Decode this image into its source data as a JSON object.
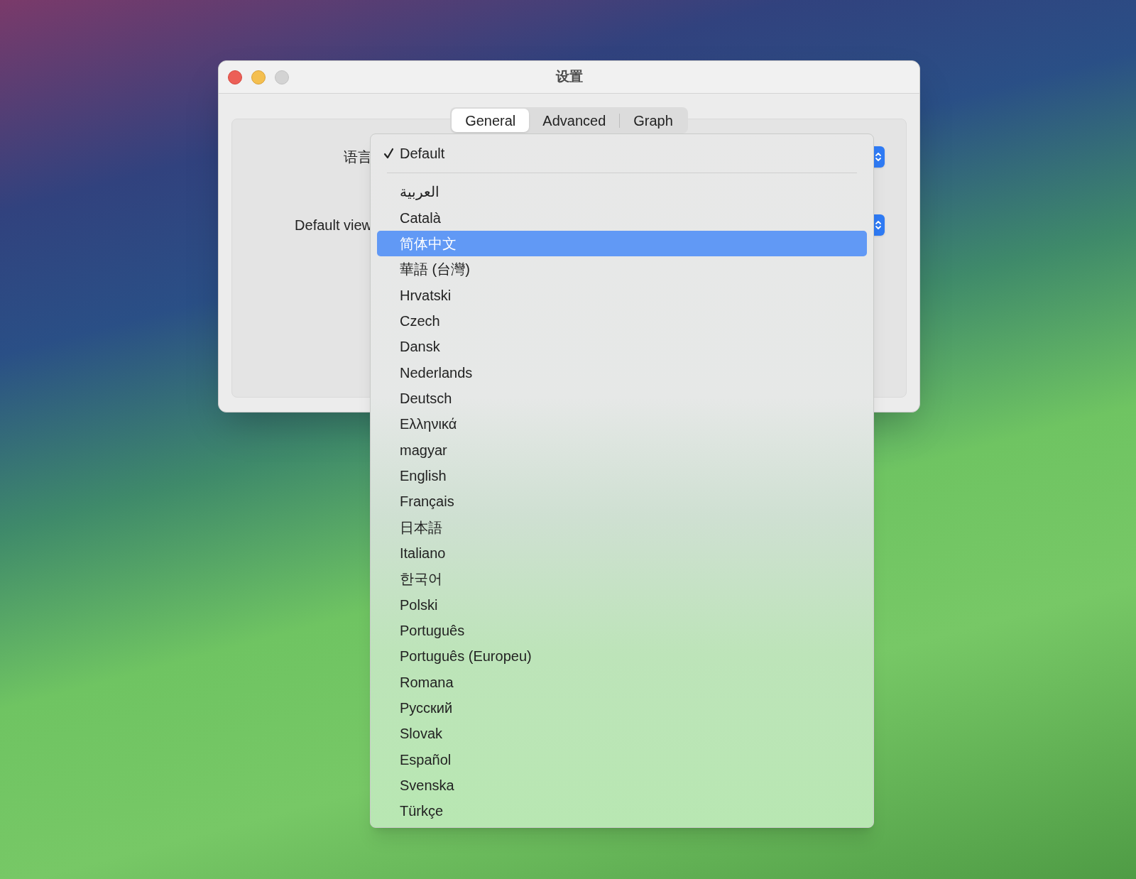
{
  "window": {
    "title": "设置"
  },
  "tabs": [
    {
      "label": "General",
      "selected": true
    },
    {
      "label": "Advanced",
      "selected": false
    },
    {
      "label": "Graph",
      "selected": false
    }
  ],
  "fields": [
    {
      "label": "语言"
    },
    {
      "label": "Default view"
    }
  ],
  "menu": {
    "items": [
      {
        "kind": "option",
        "label": "Default",
        "checked": true,
        "selected": false
      },
      {
        "kind": "separator"
      },
      {
        "kind": "option",
        "label": "العربية",
        "checked": false,
        "selected": false
      },
      {
        "kind": "option",
        "label": "Català",
        "checked": false,
        "selected": false
      },
      {
        "kind": "option",
        "label": "简体中文",
        "checked": false,
        "selected": true
      },
      {
        "kind": "option",
        "label": "華語 (台灣)",
        "checked": false,
        "selected": false
      },
      {
        "kind": "option",
        "label": "Hrvatski",
        "checked": false,
        "selected": false
      },
      {
        "kind": "option",
        "label": "Czech",
        "checked": false,
        "selected": false
      },
      {
        "kind": "option",
        "label": "Dansk",
        "checked": false,
        "selected": false
      },
      {
        "kind": "option",
        "label": "Nederlands",
        "checked": false,
        "selected": false
      },
      {
        "kind": "option",
        "label": "Deutsch",
        "checked": false,
        "selected": false
      },
      {
        "kind": "option",
        "label": "Ελληνικά",
        "checked": false,
        "selected": false
      },
      {
        "kind": "option",
        "label": "magyar",
        "checked": false,
        "selected": false
      },
      {
        "kind": "option",
        "label": "English",
        "checked": false,
        "selected": false
      },
      {
        "kind": "option",
        "label": "Français",
        "checked": false,
        "selected": false
      },
      {
        "kind": "option",
        "label": "日本語",
        "checked": false,
        "selected": false
      },
      {
        "kind": "option",
        "label": "Italiano",
        "checked": false,
        "selected": false
      },
      {
        "kind": "option",
        "label": "한국어",
        "checked": false,
        "selected": false
      },
      {
        "kind": "option",
        "label": "Polski",
        "checked": false,
        "selected": false
      },
      {
        "kind": "option",
        "label": "Português",
        "checked": false,
        "selected": false
      },
      {
        "kind": "option",
        "label": "Português (Europeu)",
        "checked": false,
        "selected": false
      },
      {
        "kind": "option",
        "label": "Romana",
        "checked": false,
        "selected": false
      },
      {
        "kind": "option",
        "label": "Русский",
        "checked": false,
        "selected": false
      },
      {
        "kind": "option",
        "label": "Slovak",
        "checked": false,
        "selected": false
      },
      {
        "kind": "option",
        "label": "Español",
        "checked": false,
        "selected": false
      },
      {
        "kind": "option",
        "label": "Svenska",
        "checked": false,
        "selected": false
      },
      {
        "kind": "option",
        "label": "Türkçe",
        "checked": false,
        "selected": false
      }
    ]
  }
}
